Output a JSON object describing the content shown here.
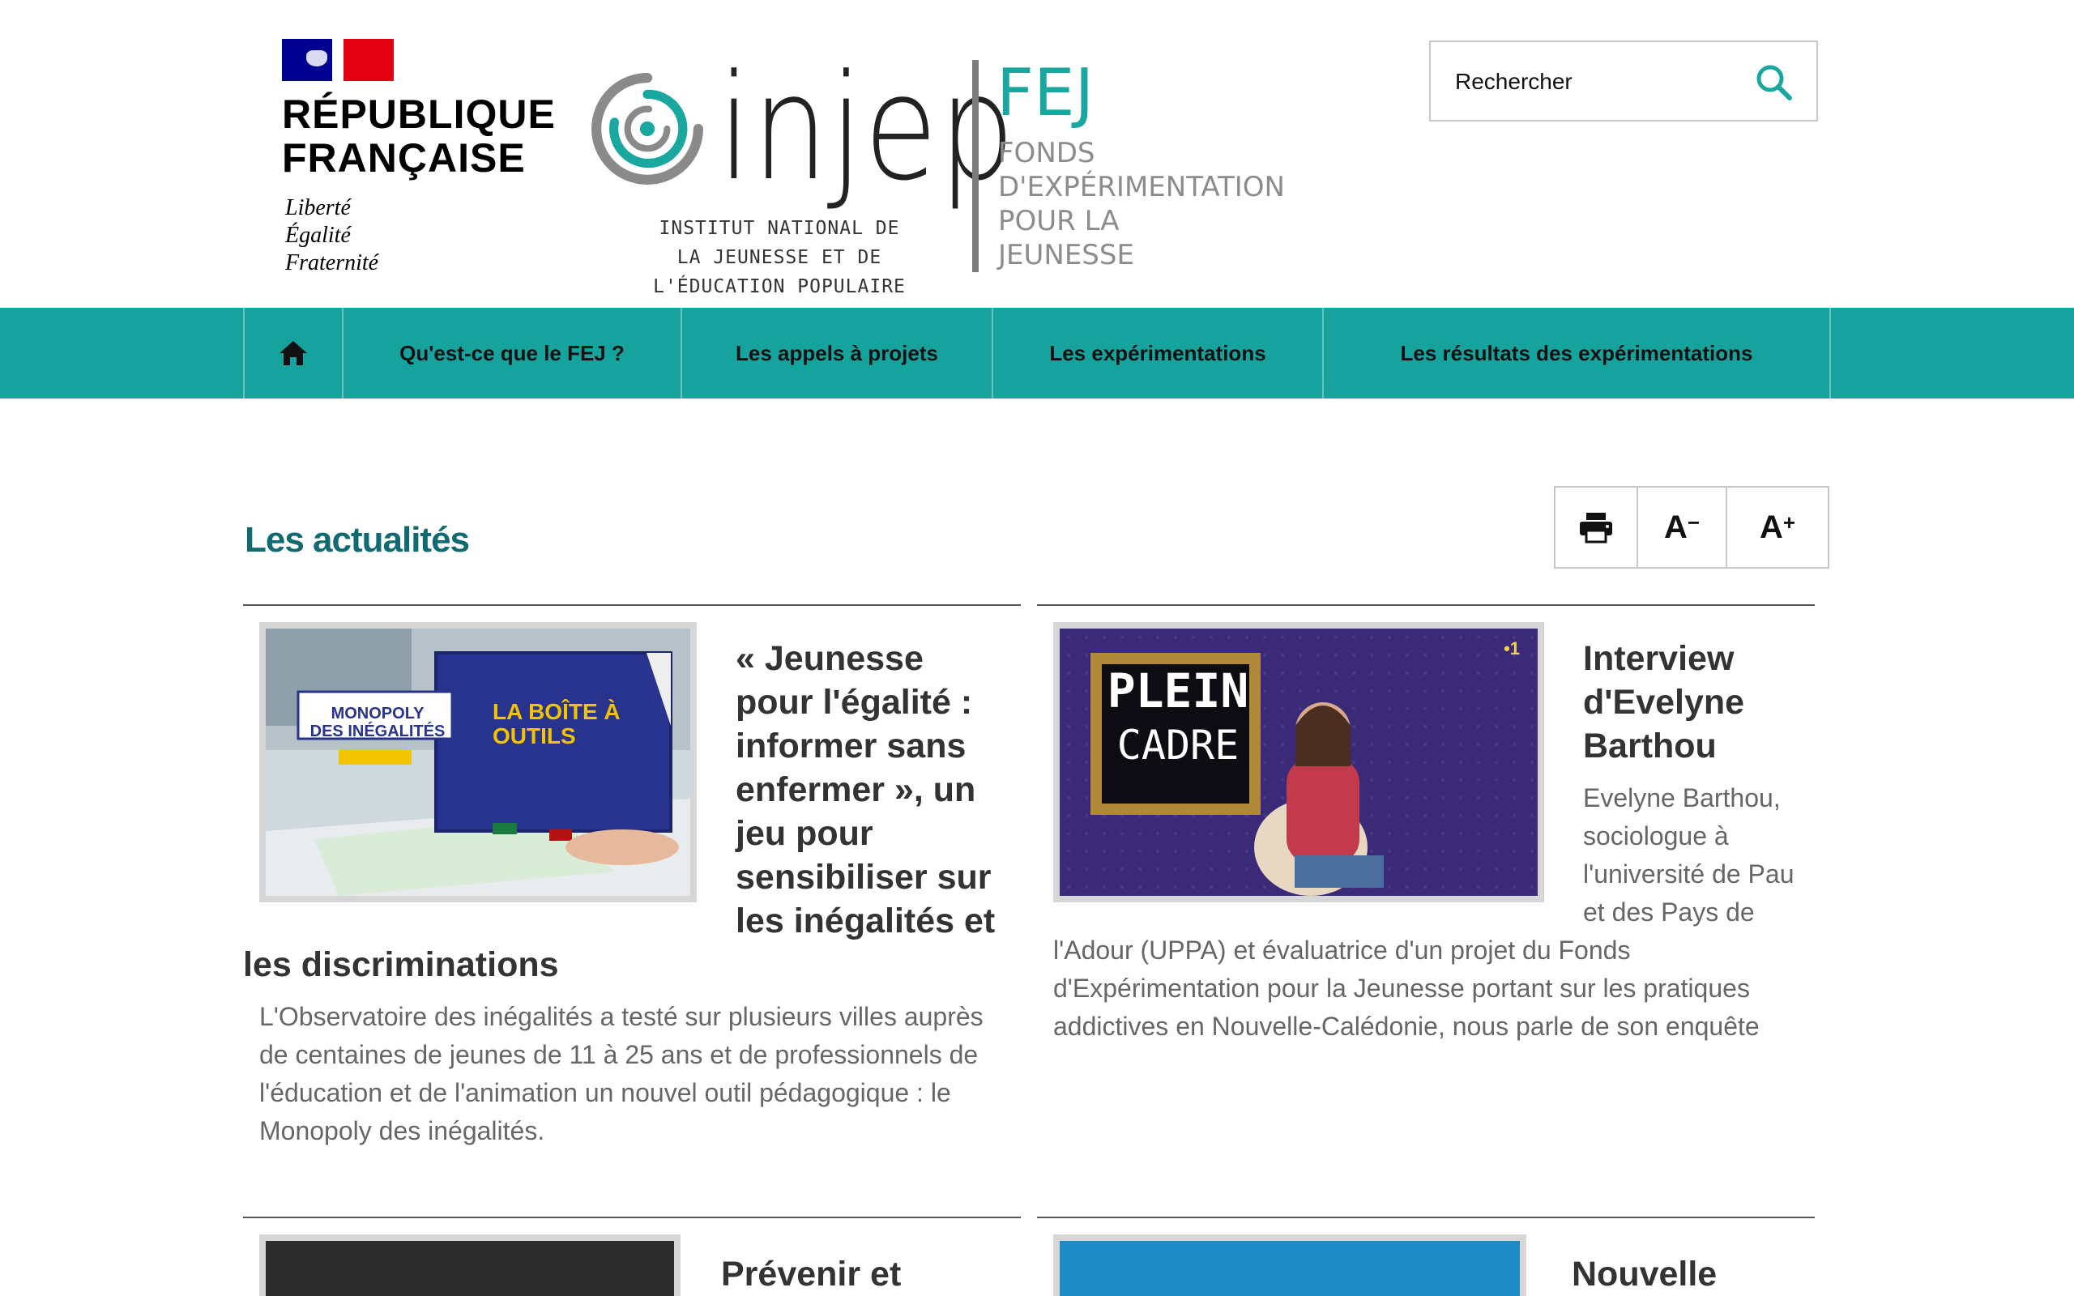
{
  "header": {
    "republic_name": "RÉPUBLIQUE\nFRANÇAISE",
    "motto": [
      "Liberté",
      "Égalité",
      "Fraternité"
    ],
    "injep_word": "injep",
    "injep_subtitle": "INSTITUT NATIONAL DE LA JEUNESSE ET DE L'ÉDUCATION POPULAIRE",
    "fej_title": "FEJ",
    "fej_subtitle": "FONDS\nD'EXPÉRIMENTATION\nPOUR LA\nJEUNESSE"
  },
  "search": {
    "placeholder": "Rechercher"
  },
  "nav": {
    "items": [
      {
        "label": "Qu'est-ce que le FEJ ?"
      },
      {
        "label": "Les appels à projets"
      },
      {
        "label": "Les expérimentations"
      },
      {
        "label": "Les résultats des expérimentations"
      }
    ]
  },
  "main": {
    "title": "Les actualités",
    "tools": {
      "minus": "A",
      "plus": "A"
    }
  },
  "cards": [
    {
      "title": "« Jeunesse pour l'égalité : informer sans enfermer », un jeu pour sensibiliser sur les inégalités et les discriminations",
      "body": "L'Observatoire des inégalités a testé sur plusieurs villes auprès de centaines de jeunes de 11 à 25 ans et de professionnels de l'éducation et de l'animation un nouvel outil pédagogique : le Monopoly des inégalités.",
      "image_texts": {
        "box_label": "MONOPOLY\nDES INÉGALITÉS",
        "box_title": "LA BOÎTE À\nOUTILS"
      }
    },
    {
      "title": "Interview d'Evelyne Barthou",
      "body": "Evelyne Barthou, sociologue à l'université de Pau et des Pays de l'Adour (UPPA) et évaluatrice d'un projet du Fonds d'Expérimentation pour la Jeunesse portant sur les pratiques addictives en Nouvelle-Calédonie, nous parle de son enquête",
      "image_texts": {
        "frame_text_1": "PLEIN",
        "frame_text_2": "CADRE",
        "channel": "•1"
      }
    }
  ],
  "next_cards": [
    {
      "title": "Prévenir et"
    },
    {
      "title": "Nouvelle"
    }
  ],
  "colors": {
    "nav_bg": "#17a39d",
    "title_teal": "#106a72",
    "fej_teal": "#1aa7a0",
    "flag_blue": "#000091",
    "flag_red": "#e1000f"
  }
}
